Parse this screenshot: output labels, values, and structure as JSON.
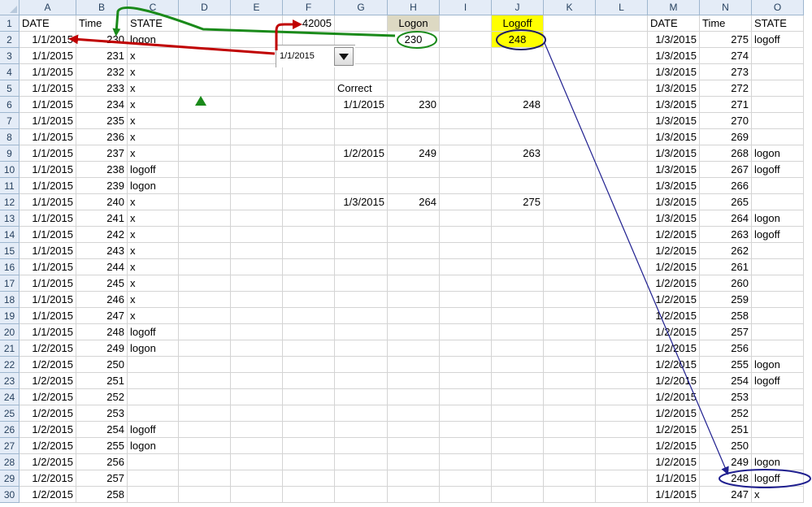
{
  "columns": [
    {
      "letter": "A",
      "w": 70
    },
    {
      "letter": "B",
      "w": 63
    },
    {
      "letter": "C",
      "w": 63
    },
    {
      "letter": "D",
      "w": 64
    },
    {
      "letter": "E",
      "w": 64
    },
    {
      "letter": "F",
      "w": 64
    },
    {
      "letter": "G",
      "w": 65
    },
    {
      "letter": "H",
      "w": 64
    },
    {
      "letter": "I",
      "w": 64
    },
    {
      "letter": "J",
      "w": 64
    },
    {
      "letter": "K",
      "w": 64
    },
    {
      "letter": "L",
      "w": 64
    },
    {
      "letter": "M",
      "w": 64
    },
    {
      "letter": "N",
      "w": 64
    },
    {
      "letter": "O",
      "w": 64
    }
  ],
  "row_count": 30,
  "cells": [
    {
      "ref": "A1",
      "v": "DATE",
      "a": "l"
    },
    {
      "ref": "B1",
      "v": "Time",
      "a": "l"
    },
    {
      "ref": "C1",
      "v": "STATE",
      "a": "l"
    },
    {
      "ref": "F1",
      "v": "42005",
      "a": "r"
    },
    {
      "ref": "H1",
      "v": "Logon",
      "a": "c",
      "hl": "logon"
    },
    {
      "ref": "J1",
      "v": "Logoff",
      "a": "c",
      "hl": "logoff"
    },
    {
      "ref": "M1",
      "v": "DATE",
      "a": "l"
    },
    {
      "ref": "N1",
      "v": "Time",
      "a": "l"
    },
    {
      "ref": "O1",
      "v": "STATE",
      "a": "l"
    },
    {
      "ref": "A2",
      "v": "1/1/2015",
      "a": "r"
    },
    {
      "ref": "B2",
      "v": "230",
      "a": "r"
    },
    {
      "ref": "C2",
      "v": "logon",
      "a": "l"
    },
    {
      "ref": "H2",
      "v": "230",
      "a": "c"
    },
    {
      "ref": "J2",
      "v": "248",
      "a": "c",
      "hl": "logoff"
    },
    {
      "ref": "M2",
      "v": "1/3/2015",
      "a": "r"
    },
    {
      "ref": "N2",
      "v": "275",
      "a": "r"
    },
    {
      "ref": "O2",
      "v": "logoff",
      "a": "l"
    },
    {
      "ref": "A3",
      "v": "1/1/2015",
      "a": "r"
    },
    {
      "ref": "B3",
      "v": "231",
      "a": "r"
    },
    {
      "ref": "C3",
      "v": "x",
      "a": "l"
    },
    {
      "ref": "M3",
      "v": "1/3/2015",
      "a": "r"
    },
    {
      "ref": "N3",
      "v": "274",
      "a": "r"
    },
    {
      "ref": "A4",
      "v": "1/1/2015",
      "a": "r"
    },
    {
      "ref": "B4",
      "v": "232",
      "a": "r"
    },
    {
      "ref": "C4",
      "v": "x",
      "a": "l"
    },
    {
      "ref": "M4",
      "v": "1/3/2015",
      "a": "r"
    },
    {
      "ref": "N4",
      "v": "273",
      "a": "r"
    },
    {
      "ref": "A5",
      "v": "1/1/2015",
      "a": "r"
    },
    {
      "ref": "B5",
      "v": "233",
      "a": "r"
    },
    {
      "ref": "C5",
      "v": "x",
      "a": "l"
    },
    {
      "ref": "G5",
      "v": "Correct",
      "a": "l"
    },
    {
      "ref": "M5",
      "v": "1/3/2015",
      "a": "r"
    },
    {
      "ref": "N5",
      "v": "272",
      "a": "r"
    },
    {
      "ref": "A6",
      "v": "1/1/2015",
      "a": "r"
    },
    {
      "ref": "B6",
      "v": "234",
      "a": "r"
    },
    {
      "ref": "C6",
      "v": "x",
      "a": "l"
    },
    {
      "ref": "G6",
      "v": "1/1/2015",
      "a": "r"
    },
    {
      "ref": "H6",
      "v": "230",
      "a": "r"
    },
    {
      "ref": "J6",
      "v": "248",
      "a": "r"
    },
    {
      "ref": "M6",
      "v": "1/3/2015",
      "a": "r"
    },
    {
      "ref": "N6",
      "v": "271",
      "a": "r"
    },
    {
      "ref": "A7",
      "v": "1/1/2015",
      "a": "r"
    },
    {
      "ref": "B7",
      "v": "235",
      "a": "r"
    },
    {
      "ref": "C7",
      "v": "x",
      "a": "l"
    },
    {
      "ref": "M7",
      "v": "1/3/2015",
      "a": "r"
    },
    {
      "ref": "N7",
      "v": "270",
      "a": "r"
    },
    {
      "ref": "A8",
      "v": "1/1/2015",
      "a": "r"
    },
    {
      "ref": "B8",
      "v": "236",
      "a": "r"
    },
    {
      "ref": "C8",
      "v": "x",
      "a": "l"
    },
    {
      "ref": "M8",
      "v": "1/3/2015",
      "a": "r"
    },
    {
      "ref": "N8",
      "v": "269",
      "a": "r"
    },
    {
      "ref": "A9",
      "v": "1/1/2015",
      "a": "r"
    },
    {
      "ref": "B9",
      "v": "237",
      "a": "r"
    },
    {
      "ref": "C9",
      "v": "x",
      "a": "l"
    },
    {
      "ref": "G9",
      "v": "1/2/2015",
      "a": "r"
    },
    {
      "ref": "H9",
      "v": "249",
      "a": "r"
    },
    {
      "ref": "J9",
      "v": "263",
      "a": "r"
    },
    {
      "ref": "M9",
      "v": "1/3/2015",
      "a": "r"
    },
    {
      "ref": "N9",
      "v": "268",
      "a": "r"
    },
    {
      "ref": "O9",
      "v": "logon",
      "a": "l"
    },
    {
      "ref": "A10",
      "v": "1/1/2015",
      "a": "r"
    },
    {
      "ref": "B10",
      "v": "238",
      "a": "r"
    },
    {
      "ref": "C10",
      "v": "logoff",
      "a": "l"
    },
    {
      "ref": "M10",
      "v": "1/3/2015",
      "a": "r"
    },
    {
      "ref": "N10",
      "v": "267",
      "a": "r"
    },
    {
      "ref": "O10",
      "v": "logoff",
      "a": "l"
    },
    {
      "ref": "A11",
      "v": "1/1/2015",
      "a": "r"
    },
    {
      "ref": "B11",
      "v": "239",
      "a": "r"
    },
    {
      "ref": "C11",
      "v": "logon",
      "a": "l"
    },
    {
      "ref": "M11",
      "v": "1/3/2015",
      "a": "r"
    },
    {
      "ref": "N11",
      "v": "266",
      "a": "r"
    },
    {
      "ref": "A12",
      "v": "1/1/2015",
      "a": "r"
    },
    {
      "ref": "B12",
      "v": "240",
      "a": "r"
    },
    {
      "ref": "C12",
      "v": "x",
      "a": "l"
    },
    {
      "ref": "G12",
      "v": "1/3/2015",
      "a": "r"
    },
    {
      "ref": "H12",
      "v": "264",
      "a": "r"
    },
    {
      "ref": "J12",
      "v": "275",
      "a": "r"
    },
    {
      "ref": "M12",
      "v": "1/3/2015",
      "a": "r"
    },
    {
      "ref": "N12",
      "v": "265",
      "a": "r"
    },
    {
      "ref": "A13",
      "v": "1/1/2015",
      "a": "r"
    },
    {
      "ref": "B13",
      "v": "241",
      "a": "r"
    },
    {
      "ref": "C13",
      "v": "x",
      "a": "l"
    },
    {
      "ref": "M13",
      "v": "1/3/2015",
      "a": "r"
    },
    {
      "ref": "N13",
      "v": "264",
      "a": "r"
    },
    {
      "ref": "O13",
      "v": "logon",
      "a": "l"
    },
    {
      "ref": "A14",
      "v": "1/1/2015",
      "a": "r"
    },
    {
      "ref": "B14",
      "v": "242",
      "a": "r"
    },
    {
      "ref": "C14",
      "v": "x",
      "a": "l"
    },
    {
      "ref": "M14",
      "v": "1/2/2015",
      "a": "r"
    },
    {
      "ref": "N14",
      "v": "263",
      "a": "r"
    },
    {
      "ref": "O14",
      "v": "logoff",
      "a": "l"
    },
    {
      "ref": "A15",
      "v": "1/1/2015",
      "a": "r"
    },
    {
      "ref": "B15",
      "v": "243",
      "a": "r"
    },
    {
      "ref": "C15",
      "v": "x",
      "a": "l"
    },
    {
      "ref": "M15",
      "v": "1/2/2015",
      "a": "r"
    },
    {
      "ref": "N15",
      "v": "262",
      "a": "r"
    },
    {
      "ref": "A16",
      "v": "1/1/2015",
      "a": "r"
    },
    {
      "ref": "B16",
      "v": "244",
      "a": "r"
    },
    {
      "ref": "C16",
      "v": "x",
      "a": "l"
    },
    {
      "ref": "M16",
      "v": "1/2/2015",
      "a": "r"
    },
    {
      "ref": "N16",
      "v": "261",
      "a": "r"
    },
    {
      "ref": "A17",
      "v": "1/1/2015",
      "a": "r"
    },
    {
      "ref": "B17",
      "v": "245",
      "a": "r"
    },
    {
      "ref": "C17",
      "v": "x",
      "a": "l"
    },
    {
      "ref": "M17",
      "v": "1/2/2015",
      "a": "r"
    },
    {
      "ref": "N17",
      "v": "260",
      "a": "r"
    },
    {
      "ref": "A18",
      "v": "1/1/2015",
      "a": "r"
    },
    {
      "ref": "B18",
      "v": "246",
      "a": "r"
    },
    {
      "ref": "C18",
      "v": "x",
      "a": "l"
    },
    {
      "ref": "M18",
      "v": "1/2/2015",
      "a": "r"
    },
    {
      "ref": "N18",
      "v": "259",
      "a": "r"
    },
    {
      "ref": "A19",
      "v": "1/1/2015",
      "a": "r"
    },
    {
      "ref": "B19",
      "v": "247",
      "a": "r"
    },
    {
      "ref": "C19",
      "v": "x",
      "a": "l"
    },
    {
      "ref": "M19",
      "v": "1/2/2015",
      "a": "r"
    },
    {
      "ref": "N19",
      "v": "258",
      "a": "r"
    },
    {
      "ref": "A20",
      "v": "1/1/2015",
      "a": "r"
    },
    {
      "ref": "B20",
      "v": "248",
      "a": "r"
    },
    {
      "ref": "C20",
      "v": "logoff",
      "a": "l"
    },
    {
      "ref": "M20",
      "v": "1/2/2015",
      "a": "r"
    },
    {
      "ref": "N20",
      "v": "257",
      "a": "r"
    },
    {
      "ref": "A21",
      "v": "1/2/2015",
      "a": "r"
    },
    {
      "ref": "B21",
      "v": "249",
      "a": "r"
    },
    {
      "ref": "C21",
      "v": "logon",
      "a": "l"
    },
    {
      "ref": "M21",
      "v": "1/2/2015",
      "a": "r"
    },
    {
      "ref": "N21",
      "v": "256",
      "a": "r"
    },
    {
      "ref": "A22",
      "v": "1/2/2015",
      "a": "r"
    },
    {
      "ref": "B22",
      "v": "250",
      "a": "r"
    },
    {
      "ref": "M22",
      "v": "1/2/2015",
      "a": "r"
    },
    {
      "ref": "N22",
      "v": "255",
      "a": "r"
    },
    {
      "ref": "O22",
      "v": "logon",
      "a": "l"
    },
    {
      "ref": "A23",
      "v": "1/2/2015",
      "a": "r"
    },
    {
      "ref": "B23",
      "v": "251",
      "a": "r"
    },
    {
      "ref": "M23",
      "v": "1/2/2015",
      "a": "r"
    },
    {
      "ref": "N23",
      "v": "254",
      "a": "r"
    },
    {
      "ref": "O23",
      "v": "logoff",
      "a": "l"
    },
    {
      "ref": "A24",
      "v": "1/2/2015",
      "a": "r"
    },
    {
      "ref": "B24",
      "v": "252",
      "a": "r"
    },
    {
      "ref": "M24",
      "v": "1/2/2015",
      "a": "r"
    },
    {
      "ref": "N24",
      "v": "253",
      "a": "r"
    },
    {
      "ref": "A25",
      "v": "1/2/2015",
      "a": "r"
    },
    {
      "ref": "B25",
      "v": "253",
      "a": "r"
    },
    {
      "ref": "M25",
      "v": "1/2/2015",
      "a": "r"
    },
    {
      "ref": "N25",
      "v": "252",
      "a": "r"
    },
    {
      "ref": "A26",
      "v": "1/2/2015",
      "a": "r"
    },
    {
      "ref": "B26",
      "v": "254",
      "a": "r"
    },
    {
      "ref": "C26",
      "v": "logoff",
      "a": "l"
    },
    {
      "ref": "M26",
      "v": "1/2/2015",
      "a": "r"
    },
    {
      "ref": "N26",
      "v": "251",
      "a": "r"
    },
    {
      "ref": "A27",
      "v": "1/2/2015",
      "a": "r"
    },
    {
      "ref": "B27",
      "v": "255",
      "a": "r"
    },
    {
      "ref": "C27",
      "v": "logon",
      "a": "l"
    },
    {
      "ref": "M27",
      "v": "1/2/2015",
      "a": "r"
    },
    {
      "ref": "N27",
      "v": "250",
      "a": "r"
    },
    {
      "ref": "A28",
      "v": "1/2/2015",
      "a": "r"
    },
    {
      "ref": "B28",
      "v": "256",
      "a": "r"
    },
    {
      "ref": "M28",
      "v": "1/2/2015",
      "a": "r"
    },
    {
      "ref": "N28",
      "v": "249",
      "a": "r"
    },
    {
      "ref": "O28",
      "v": "logon",
      "a": "l"
    },
    {
      "ref": "A29",
      "v": "1/2/2015",
      "a": "r"
    },
    {
      "ref": "B29",
      "v": "257",
      "a": "r"
    },
    {
      "ref": "M29",
      "v": "1/1/2015",
      "a": "r"
    },
    {
      "ref": "N29",
      "v": "248",
      "a": "r"
    },
    {
      "ref": "O29",
      "v": "logoff",
      "a": "l"
    },
    {
      "ref": "A30",
      "v": "1/2/2015",
      "a": "r"
    },
    {
      "ref": "B30",
      "v": "258",
      "a": "r"
    },
    {
      "ref": "M30",
      "v": "1/1/2015",
      "a": "r"
    },
    {
      "ref": "N30",
      "v": "247",
      "a": "r"
    },
    {
      "ref": "O30",
      "v": "x",
      "a": "l"
    }
  ],
  "combo": {
    "value": "1/1/2015"
  },
  "colors": {
    "logon_fill": "#ddd9c3",
    "logoff_fill": "#ffff00",
    "arrow_green": "#1a8a1a",
    "arrow_red": "#c00000",
    "arrow_blue": "#1f1f8f"
  }
}
